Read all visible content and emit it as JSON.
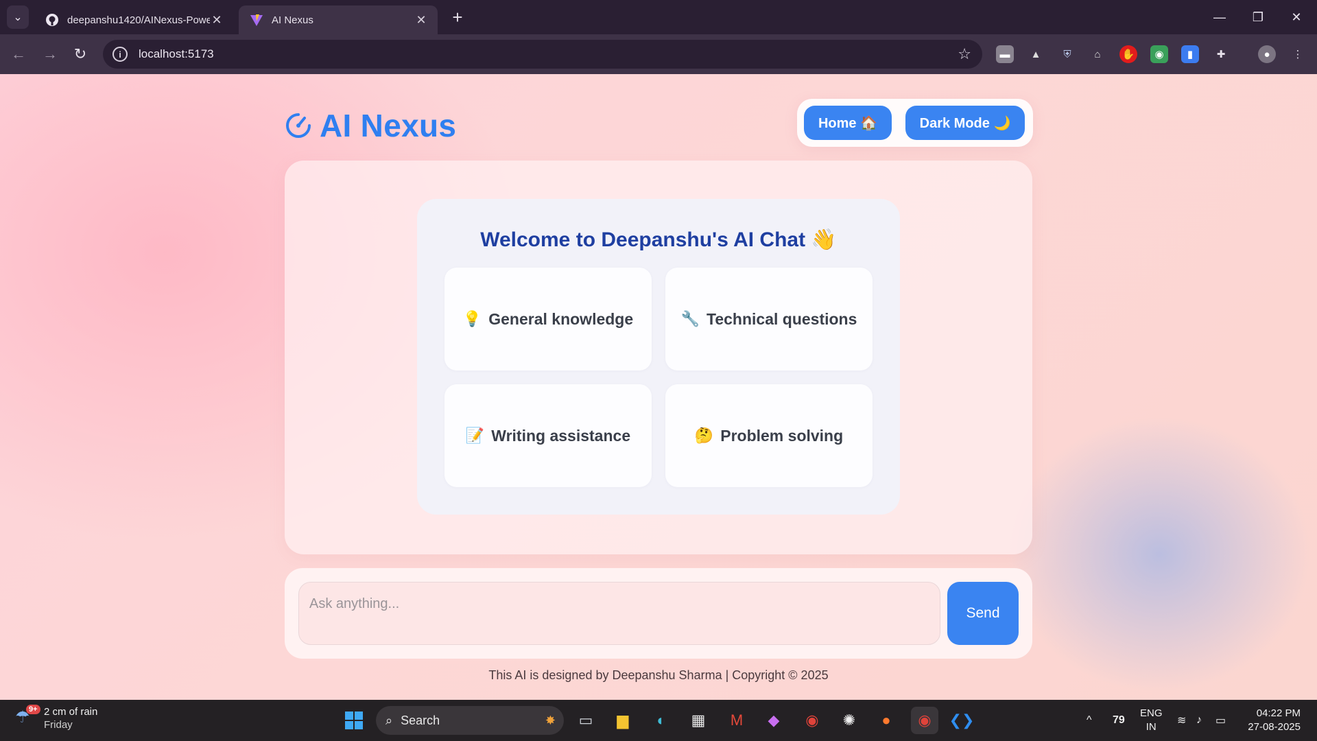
{
  "browser": {
    "tabs": [
      {
        "title": "deepanshu1420/AINexus-Powe",
        "active": false
      },
      {
        "title": "AI Nexus",
        "active": true
      }
    ],
    "url": "localhost:5173"
  },
  "header": {
    "brand_name": "AI Nexus",
    "home_label": "Home 🏠",
    "dark_mode_label": "Dark Mode 🌙"
  },
  "welcome": {
    "title": "Welcome to Deepanshu's AI Chat 👋",
    "topics": [
      {
        "emoji": "💡",
        "label": "General knowledge"
      },
      {
        "emoji": "🔧",
        "label": "Technical questions"
      },
      {
        "emoji": "📝",
        "label": "Writing assistance"
      },
      {
        "emoji": "🤔",
        "label": "Problem solving"
      }
    ]
  },
  "input": {
    "placeholder": "Ask anything...",
    "send_label": "Send"
  },
  "footer": {
    "text": "This AI is designed by Deepanshu Sharma | Copyright © 2025"
  },
  "taskbar": {
    "weather_title": "2 cm of rain",
    "weather_day": "Friday",
    "weather_badge": "9+",
    "search_label": "Search",
    "tray_value": "79",
    "lang_top": "ENG",
    "lang_bottom": "IN",
    "time": "04:22 PM",
    "date": "27-08-2025"
  },
  "colors": {
    "accent": "#3a84f1",
    "brand": "#2f7ff0",
    "title": "#1f3fa1"
  }
}
